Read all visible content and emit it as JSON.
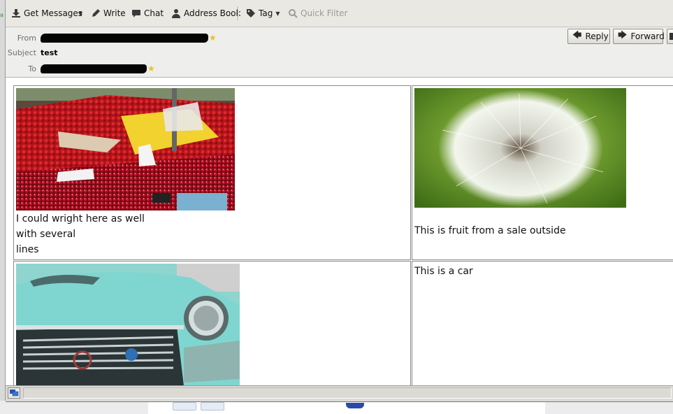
{
  "toolbar": {
    "get_messages": "Get Messages",
    "write": "Write",
    "chat": "Chat",
    "address_book": "Address Book",
    "tag": "Tag",
    "quick_filter": "Quick Filter"
  },
  "message_header": {
    "from_label": "From",
    "subject_label": "Subject",
    "subject_value": "test",
    "to_label": "To",
    "reply_label": "Reply",
    "forward_label": "Forward"
  },
  "message_body": {
    "cell_1_lines": [
      "I could wright here as well",
      "with several",
      "lines"
    ],
    "cell_2_text": "This is fruit from a sale outside",
    "cell_3_text": "This is a car"
  },
  "colors": {
    "toolbar_bg": "#eae8e3",
    "header_bg": "#eeeeec",
    "star": "#e8c21a",
    "redaction": "#050505"
  }
}
